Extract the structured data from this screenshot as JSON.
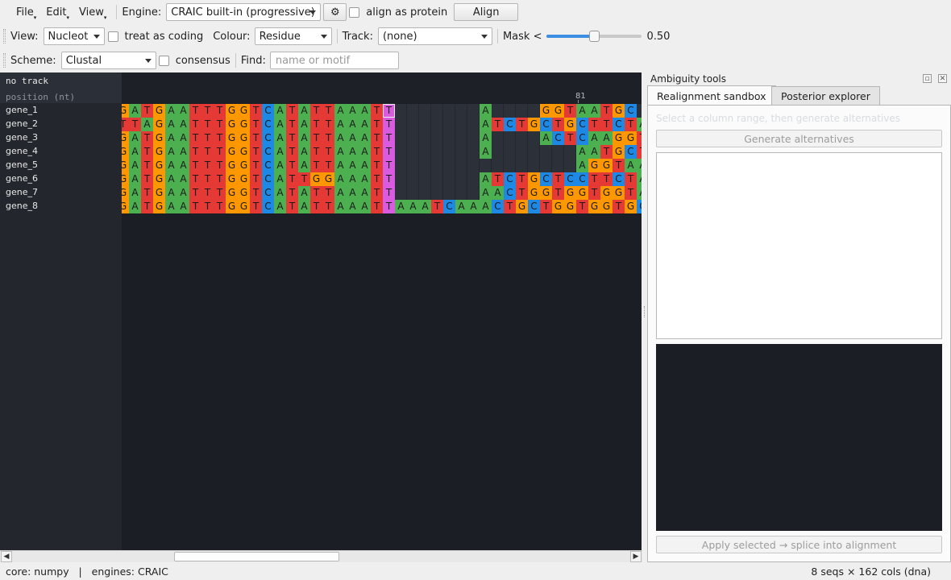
{
  "menus": [
    "File",
    "Edit",
    "View"
  ],
  "toolbar1": {
    "engine_label": "Engine:",
    "engine_value": "CRAIC built-in (progressive)",
    "settings_icon": "gear-icon",
    "align_protein_label": "align as protein",
    "align_protein_checked": false,
    "align_button": "Align"
  },
  "toolbar2": {
    "view_label": "View:",
    "view_value": "Nucleotide",
    "coding_label": "treat as coding",
    "coding_checked": false,
    "colour_label": "Colour:",
    "colour_value": "Residue",
    "track_label": "Track:",
    "track_value": "(none)",
    "mask_label": "Mask <",
    "mask_value": 0.5,
    "mask_text": "0.50"
  },
  "toolbar3": {
    "scheme_label": "Scheme:",
    "scheme_value": "Clustal",
    "consensus_label": "consensus",
    "consensus_checked": false,
    "find_label": "Find:",
    "find_placeholder": "name or motif"
  },
  "track_header": {
    "track_name": "no track",
    "ruler_label": "position (nt)"
  },
  "ruler": {
    "marker": "81"
  },
  "sequences": [
    {
      "name": "gene_1",
      "seq": "GATGAATTTGGTCATATTAAATT-------A----GGTAATGC---"
    },
    {
      "name": "gene_2",
      "seq": "TTAGAATTTGGTCATATTAAATT-------ATCTGCTGCTTCTAA"
    },
    {
      "name": "gene_3",
      "seq": "GATGAATTTGGTCATATTAAATT-------A----ACTCAAGGTAA"
    },
    {
      "name": "gene_4",
      "seq": "GATGAATTTGGTCATATTAAATT-------A-------AATGCTCC"
    },
    {
      "name": "gene_5",
      "seq": "GATGAATTTGGTCATATTAAATT---------------AGGTAA"
    },
    {
      "name": "gene_6",
      "seq": "GATGAATTTGGTCATTGGAAATT-------ATCTGCTCCTTCTAA"
    },
    {
      "name": "gene_7",
      "seq": "GATGAATTTGGTCATATTAAATT-------AACTGGTGGTGGTAA"
    },
    {
      "name": "gene_8",
      "seq": "GATGAATTTGGTCATATTAAATTAAATCAAACTGCTGGTGGTGC"
    }
  ],
  "residue_colors": {
    "A": "#4caf50",
    "T": "#e53935",
    "G": "#ff9800",
    "C": "#1e88e5",
    "highlight_T": "#d95be0"
  },
  "dock": {
    "title": "Ambiguity tools",
    "tabs": [
      "Realignment sandbox",
      "Posterior explorer"
    ],
    "active_tab": 0,
    "hint": "Select a column range, then generate alternatives",
    "generate_button": "Generate alternatives",
    "apply_button": "Apply selected → splice into alignment"
  },
  "status": {
    "left": "core: numpy   |   engines: CRAIC",
    "right": "8 seqs × 162 cols (dna)"
  }
}
